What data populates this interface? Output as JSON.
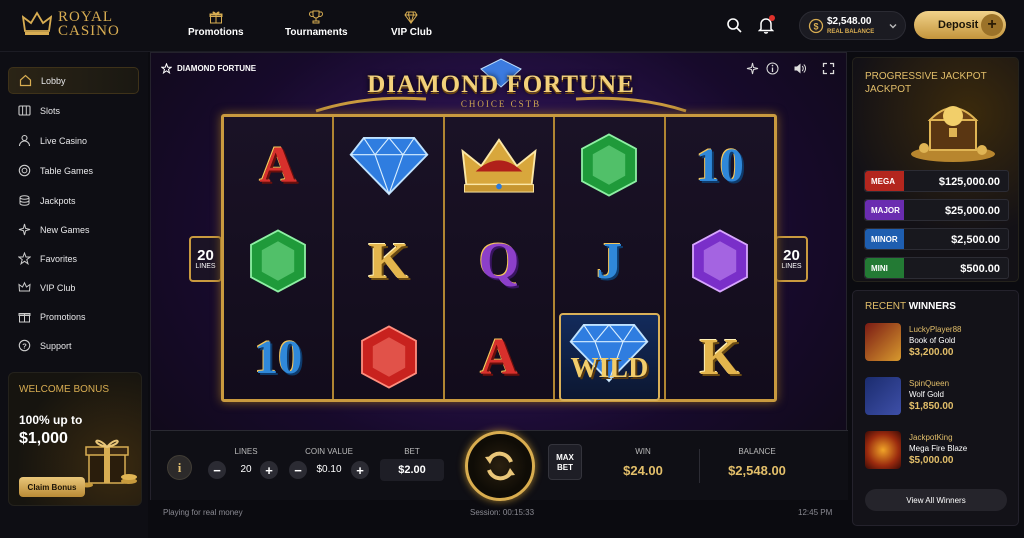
{
  "brand": {
    "line1": "ROYAL",
    "line2": "CASINO"
  },
  "topnav": [
    {
      "label": "Promotions",
      "icon": "gift-icon"
    },
    {
      "label": "Tournaments",
      "icon": "trophy-icon"
    },
    {
      "label": "VIP Club",
      "icon": "diamond-icon"
    }
  ],
  "account": {
    "balance": "$2,548.00",
    "balance_label": "REAL BALANCE",
    "deposit_label": "Deposit"
  },
  "sidebar": {
    "items": [
      {
        "label": "Lobby",
        "icon": "home-icon"
      },
      {
        "label": "Slots",
        "icon": "slots-icon"
      },
      {
        "label": "Live Casino",
        "icon": "live-dealer-icon"
      },
      {
        "label": "Table Games",
        "icon": "chip-icon"
      },
      {
        "label": "Jackpots",
        "icon": "coins-icon"
      },
      {
        "label": "New Games",
        "icon": "sparkle-icon"
      },
      {
        "label": "Favorites",
        "icon": "star-icon"
      },
      {
        "label": "VIP Club",
        "icon": "crown-icon"
      },
      {
        "label": "Promotions",
        "icon": "gift-icon"
      },
      {
        "label": "Support",
        "icon": "help-icon"
      }
    ],
    "bonus": {
      "title": "WELCOME BONUS",
      "line1": "100% up to",
      "line2": "$1,000",
      "button": "Claim Bonus"
    }
  },
  "game": {
    "name": "DIAMOND FORTUNE",
    "banner_title": "DIAMOND FORTUNE",
    "banner_sub": "CHOICE CSTB",
    "lines_badge": {
      "number": "20",
      "label": "LINES"
    },
    "reels": [
      [
        "A",
        "green-gem",
        "10"
      ],
      [
        "blue-diamond",
        "K",
        "red-gem"
      ],
      [
        "crown",
        "Q",
        "A"
      ],
      [
        "green-gem",
        "J",
        "WILD"
      ],
      [
        "10",
        "purple-gem",
        "K"
      ]
    ],
    "wild_label": "WILD",
    "controls": {
      "info": "i",
      "lines_label": "LINES",
      "lines_value": "20",
      "coin_label": "COIN VALUE",
      "coin_value": "$0.10",
      "bet_label": "BET",
      "bet_value": "$2.00",
      "maxbet_label": "MAX\nBET",
      "win_label": "WIN",
      "win_value": "$24.00",
      "balance_label": "BALANCE",
      "balance_value": "$2,548.00"
    },
    "footer": {
      "mode": "Playing for real money",
      "session": "Session: 00:15:33",
      "time": "12:45 PM"
    }
  },
  "jackpots": {
    "title": "PROGRESSIVE JACKPOT JACKPOT",
    "tiers": [
      {
        "name": "MEGA",
        "value": "$125,000.00",
        "color": "#b3261e"
      },
      {
        "name": "MAJOR",
        "value": "$25,000.00",
        "color": "#6a2cb0"
      },
      {
        "name": "MINOR",
        "value": "$2,500.00",
        "color": "#1e5eb0"
      },
      {
        "name": "MINI",
        "value": "$500.00",
        "color": "#237a34"
      }
    ]
  },
  "winners": {
    "title_part1": "RECENT",
    "title_part2": "WINNERS",
    "list": [
      {
        "name": "LuckyPlayer88",
        "game": "Book of Gold",
        "amount": "$3,200.00"
      },
      {
        "name": "SpinQueen",
        "game": "Wolf Gold",
        "amount": "$1,850.00"
      },
      {
        "name": "JackpotKing",
        "game": "Mega Fire Blaze",
        "amount": "$5,000.00"
      }
    ],
    "view_all": "View All Winners"
  },
  "colors": {
    "gold": "#d8ad52",
    "bg": "#0b0b10"
  }
}
